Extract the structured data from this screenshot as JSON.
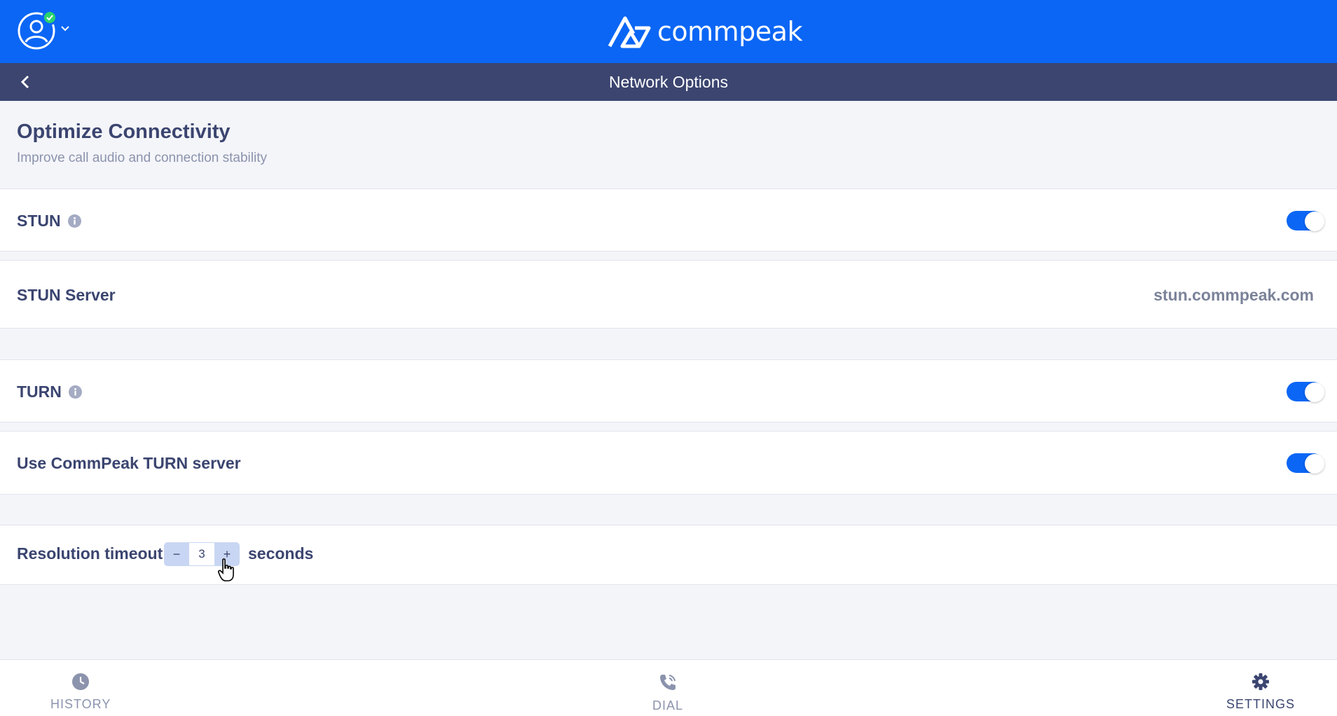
{
  "brand": {
    "name": "commpeak"
  },
  "header": {
    "title": "Network Options"
  },
  "section": {
    "title": "Optimize Connectivity",
    "subtitle": "Improve call audio and connection stability"
  },
  "settings": {
    "stun": {
      "label": "STUN",
      "enabled": true
    },
    "stun_server": {
      "label": "STUN Server",
      "value": "stun.commpeak.com"
    },
    "turn": {
      "label": "TURN",
      "enabled": true
    },
    "commpeak_turn": {
      "label": "Use CommPeak TURN server",
      "enabled": true
    },
    "resolution_timeout": {
      "label": "Resolution timeout",
      "minus": "−",
      "value": "3",
      "plus": "+",
      "unit": "seconds"
    }
  },
  "nav": {
    "history": "HISTORY",
    "dial": "DIAL",
    "settings": "SETTINGS",
    "active": "settings"
  },
  "colors": {
    "primary": "#0b66f5",
    "subheader": "#3b4570",
    "status_online": "#2bd36b"
  }
}
